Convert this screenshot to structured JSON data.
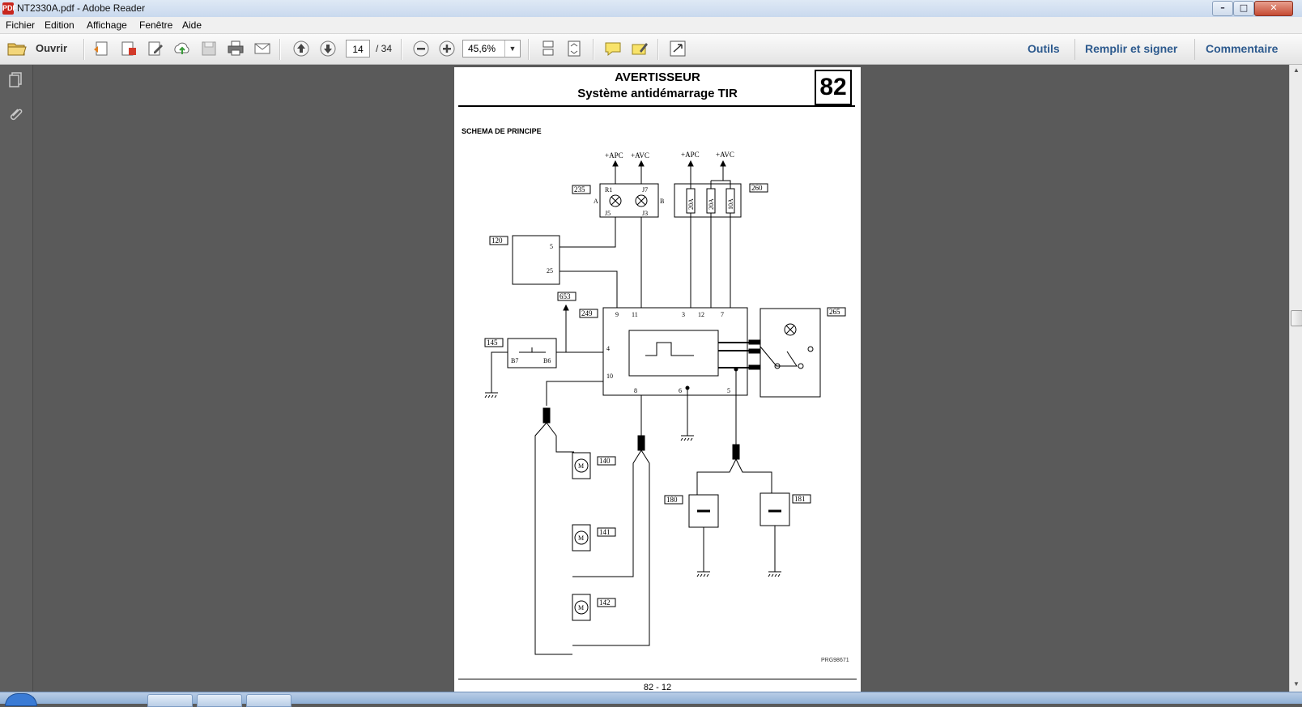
{
  "window": {
    "title": "NT2330A.pdf - Adobe Reader",
    "app_icon_text": "PDF",
    "minimize": "–",
    "maximize": "□",
    "close": "✕"
  },
  "menu": [
    "Fichier",
    "Edition",
    "Affichage",
    "Fenêtre",
    "Aide"
  ],
  "toolbar": {
    "open_label": "Ouvrir",
    "page_current": "14",
    "page_total": "/ 34",
    "zoom": "45,6%",
    "zoom_arrow": "▼",
    "tools_label": "Outils",
    "fill_sign_label": "Remplir et signer",
    "comment_label": "Commentaire"
  },
  "document": {
    "title": "AVERTISSEUR",
    "subtitle": "Système antidémarrage TIR",
    "section_number": "82",
    "schema_label": "SCHEMA DE PRINCIPE",
    "reference": "PRG98671",
    "page_number": "82 - 12",
    "diagram": {
      "supplies": [
        "+APC",
        "+AVC",
        "+APC",
        "+AVC"
      ],
      "components": [
        "235",
        "260",
        "120",
        "653",
        "249",
        "265",
        "145",
        "140",
        "141",
        "142",
        "180",
        "181"
      ],
      "pins_235": [
        "R1",
        "J7",
        "J5",
        "J3",
        "A",
        "B"
      ],
      "fuses_260": [
        "20A",
        "20A",
        "10A"
      ],
      "pins_120": [
        "5",
        "25"
      ],
      "pins_249": [
        "9",
        "11",
        "3",
        "12",
        "7",
        "4",
        "10",
        "8",
        "6",
        "5"
      ],
      "pins_145": [
        "B7",
        "B6"
      ]
    }
  },
  "colors": {
    "link": "#2d5a8e",
    "background": "#5a5a5a",
    "toolbar": "#ececec"
  }
}
